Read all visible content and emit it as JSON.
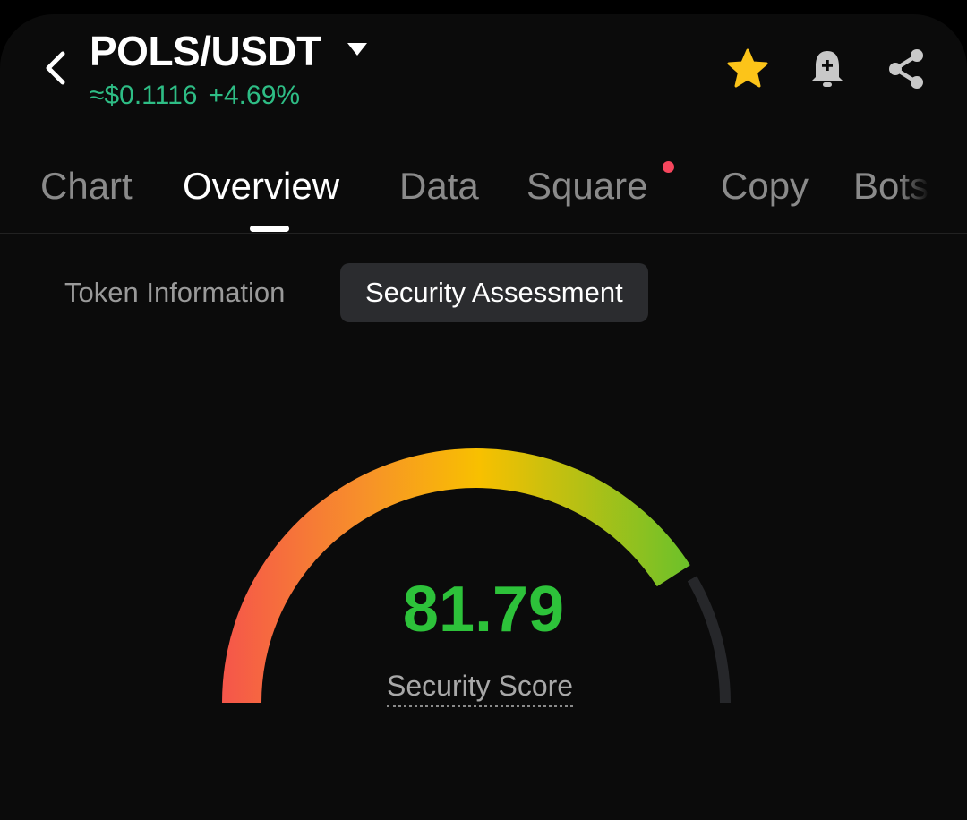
{
  "header": {
    "pair": "POLS/USDT",
    "price": "≈$0.1116",
    "change": "+4.69%",
    "favorite_icon": "star-icon",
    "alert_icon": "bell-plus-icon",
    "share_icon": "share-icon",
    "colors": {
      "up": "#2ebd85",
      "star": "#fcc419"
    }
  },
  "tabs": [
    {
      "label": "Chart"
    },
    {
      "label": "Overview",
      "active": true
    },
    {
      "label": "Data"
    },
    {
      "label": "Square",
      "badge": true
    },
    {
      "label": "Copy"
    },
    {
      "label": "Bots"
    }
  ],
  "subtabs": [
    {
      "label": "Token Information"
    },
    {
      "label": "Security Assessment",
      "active": true
    }
  ],
  "gauge": {
    "score": "81.79",
    "score_value": 81.79,
    "max": 100,
    "label": "Security Score",
    "colors": [
      "#f5564a",
      "#f7902a",
      "#f8c000",
      "#6cc12a"
    ],
    "track_color": "#26272a",
    "score_color": "#2dc23a"
  }
}
